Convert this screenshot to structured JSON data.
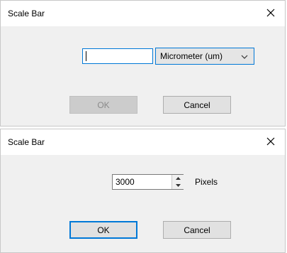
{
  "dialog1": {
    "title": "Scale Bar",
    "value_input": {
      "value": ""
    },
    "unit_select": {
      "selected": "Micrometer (um)"
    },
    "ok_label": "OK",
    "cancel_label": "Cancel"
  },
  "dialog2": {
    "title": "Scale Bar",
    "pixels_input": {
      "value": "3000"
    },
    "pixels_label": "Pixels",
    "ok_label": "OK",
    "cancel_label": "Cancel"
  },
  "colors": {
    "dialog_bg": "#f0f0f0",
    "titlebar_bg": "#ffffff",
    "focus_blue": "#0078d7",
    "button_bg": "#e1e1e1",
    "disabled_text": "#8a8a8a"
  },
  "icons": {
    "close": "close-icon",
    "dropdown": "chevron-down-icon",
    "spin_up": "spin-up-icon",
    "spin_down": "spin-down-icon"
  }
}
